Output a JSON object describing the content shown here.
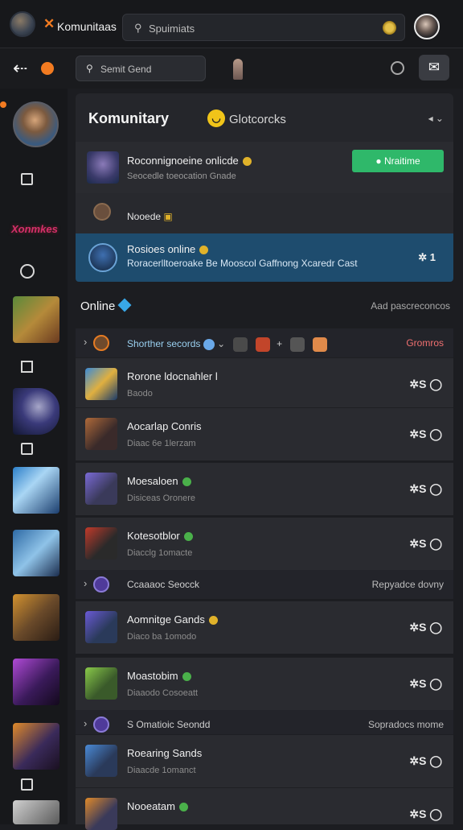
{
  "topbar": {
    "brand": "Komunitaas",
    "search_placeholder": "Spuimiats"
  },
  "subbar": {
    "search_placeholder": "Semit Gend"
  },
  "sidebar": {
    "logo_text": "Xonmkes"
  },
  "header": {
    "title": "Komunitary",
    "subtitle": "Glotcorcks"
  },
  "featured": [
    {
      "title": "Roconnignoeine onlicde",
      "subtitle": "Seocedle toeocation Gnade",
      "button": "Nraitime"
    },
    {
      "title": "Nooede"
    },
    {
      "title": "Rosioes online",
      "subtitle": "Roracerlltoeroake Be Mooscol Gaffnong Xcaredr Cast",
      "count": "✲ 1"
    }
  ],
  "online": {
    "title": "Online",
    "right": "Aad pascreconcos"
  },
  "groups": [
    {
      "label": "Shorther secords",
      "right": "Gromros"
    },
    {
      "label": "Ccaaaoc Seocck",
      "right": "Repyadce dovny"
    },
    {
      "label": "S Omatioic Seondd",
      "right": "Sopradocs mome"
    }
  ],
  "rows": [
    {
      "title": "Rorone ldocnahler l",
      "subtitle": "Baodo",
      "action": "✲S ◯"
    },
    {
      "title": "Aocarlap Conris",
      "subtitle": "Diaac 6e 1lerzam",
      "action": "✲S ◯"
    },
    {
      "title": "Moesaloen",
      "subtitle": "Disiceas Oronere",
      "action": "✲S ◯"
    },
    {
      "title": "Kotesotblor",
      "subtitle": "Diacclg 1omacte",
      "action": "✲S ◯"
    },
    {
      "title": "Aomnitge Gands",
      "subtitle": "Diaco ba 1omodo",
      "action": "✲S ◯"
    },
    {
      "title": "Moastobim",
      "subtitle": "Diaaodo Cosoeatt",
      "action": "✲S ◯"
    },
    {
      "title": "Roearing Sands",
      "subtitle": "Diaacde 1omanct",
      "action": "✲S ◯"
    },
    {
      "title": "Nooeatam",
      "subtitle": "",
      "action": "✲S ◯"
    }
  ],
  "colors": {
    "accent": "#f27b21",
    "green_button": "#2fb86a",
    "highlight_card": "#1e4c6e"
  }
}
